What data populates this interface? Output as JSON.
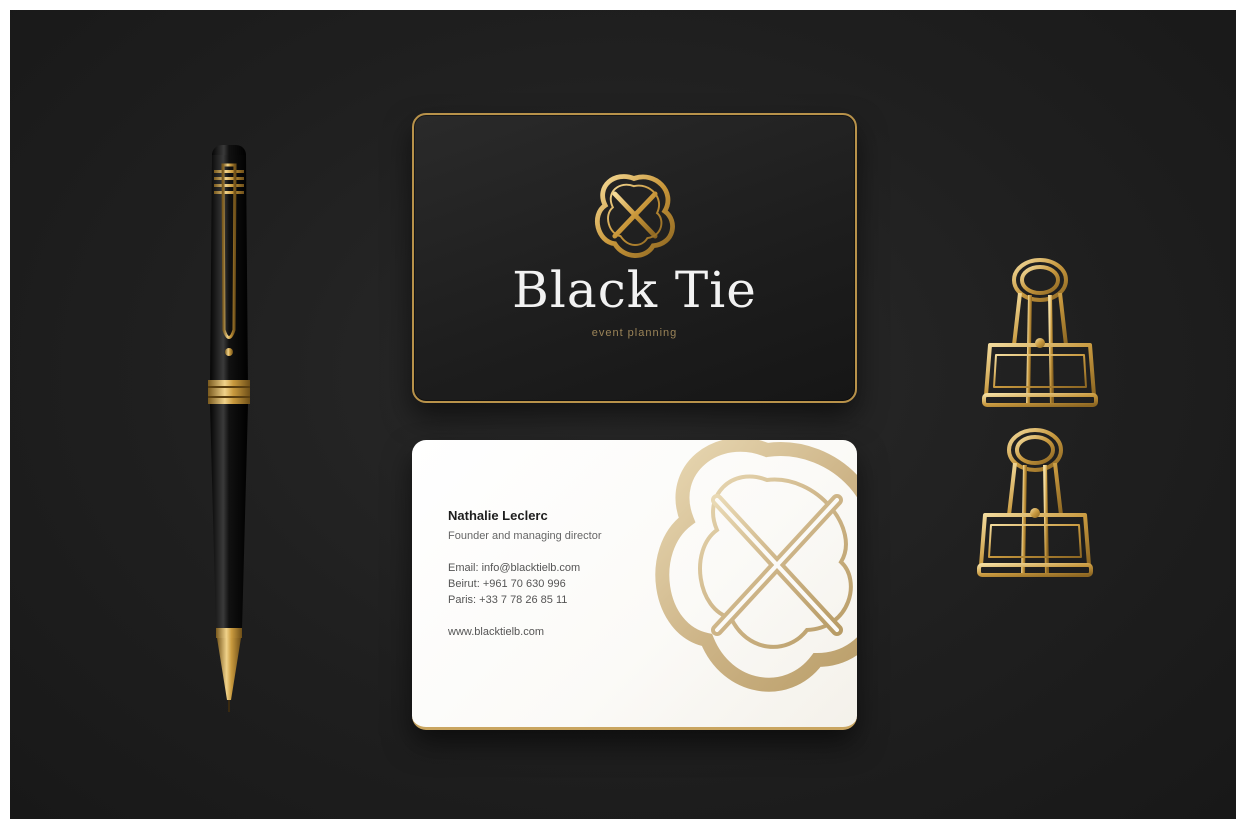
{
  "front_card": {
    "brand_name": "Black Tie",
    "tagline": "event planning"
  },
  "back_card": {
    "name": "Nathalie Leclerc",
    "role": "Founder and managing director",
    "email": "Email: info@blacktielb.com",
    "beirut": "Beirut: +961 70 630 996",
    "paris": "Paris: +33 7 78 26 85 11",
    "website": "www.blacktielb.com"
  },
  "colors": {
    "background": "#1f1f1f",
    "gold": "#c9a560",
    "card_dark": "#1d1d1d",
    "card_light": "#ffffff"
  },
  "icons": [
    "black-tie-logo-icon",
    "pen-icon",
    "binder-clip-icon"
  ]
}
